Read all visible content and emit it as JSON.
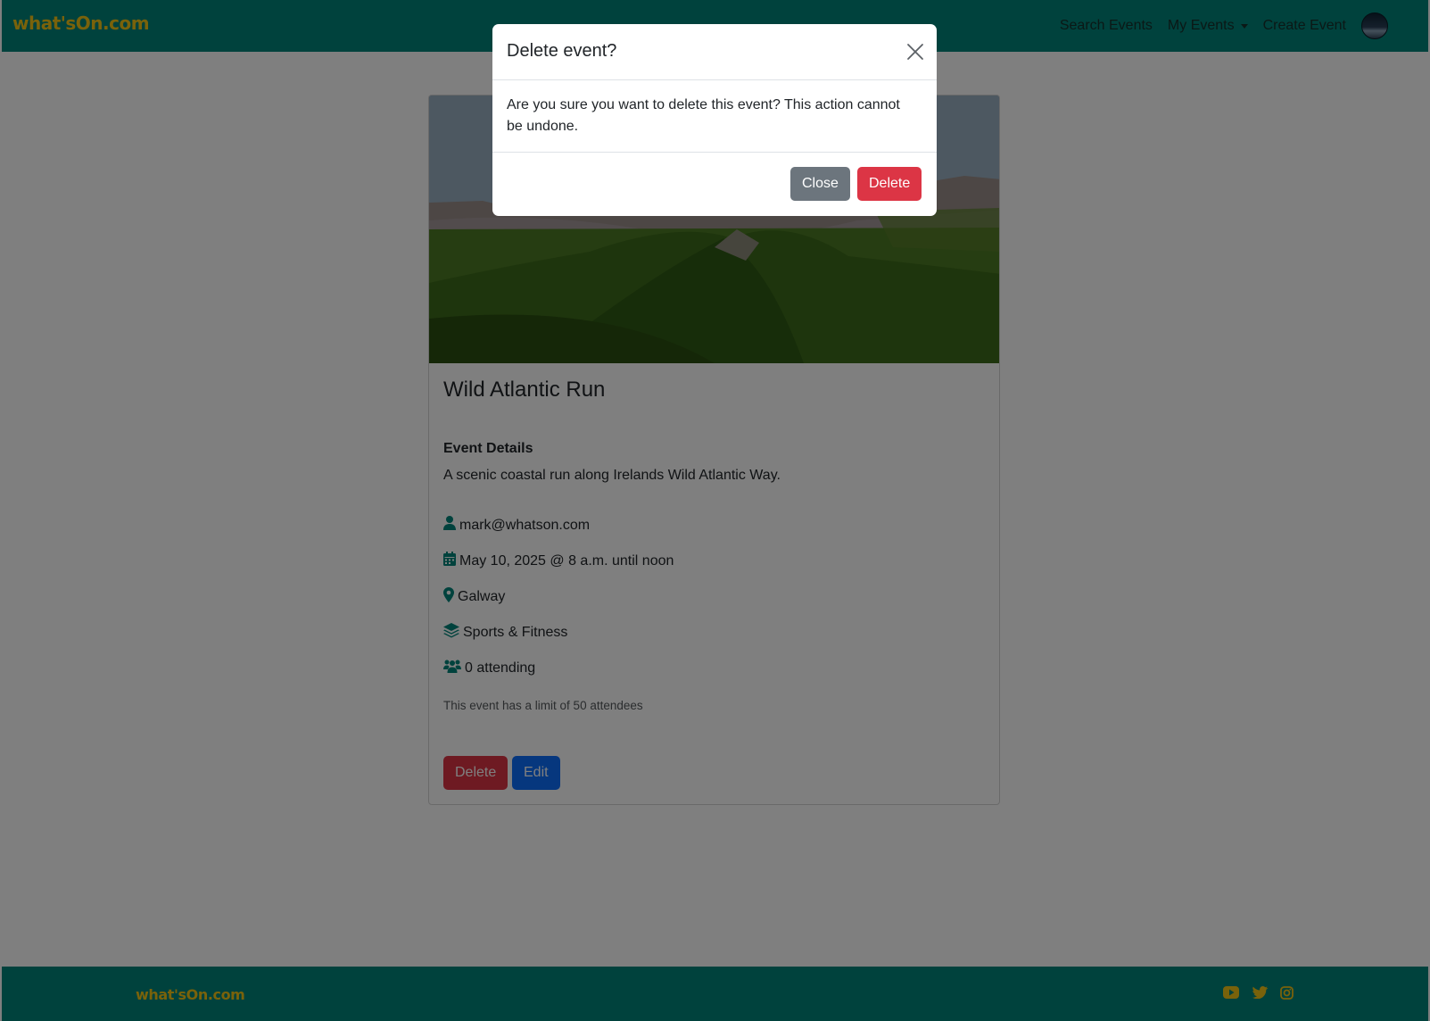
{
  "navbar": {
    "brand": "what'sOn.com",
    "links": {
      "search": "Search Events",
      "my_events": "My Events",
      "create": "Create Event"
    }
  },
  "event": {
    "title": "Wild Atlantic Run",
    "details_heading": "Event Details",
    "description": "A scenic coastal run along Irelands Wild Atlantic Way.",
    "organizer": "mark@whatson.com",
    "datetime": "May 10, 2025 @ 8 a.m. until noon",
    "location": "Galway",
    "category": "Sports & Fitness",
    "attending": "0 attending",
    "limit_note": "This event has a limit of 50 attendees",
    "icons": [
      "user-icon",
      "calendar-icon",
      "location-pin-icon",
      "layers-icon",
      "users-icon"
    ],
    "actions": {
      "delete": "Delete",
      "edit": "Edit"
    }
  },
  "modal": {
    "title": "Delete event?",
    "body": "Are you sure you want to delete this event? This action cannot be undone.",
    "close_label": "Close",
    "delete_label": "Delete"
  },
  "footer": {
    "brand": "what'sOn.com",
    "social_icons": [
      "youtube-icon",
      "twitter-icon",
      "instagram-icon"
    ]
  },
  "colors": {
    "brand_teal": "#00847a",
    "brand_yellow": "#f2c417",
    "danger": "#dc3545",
    "primary": "#0d6efd",
    "secondary": "#6c757d"
  }
}
